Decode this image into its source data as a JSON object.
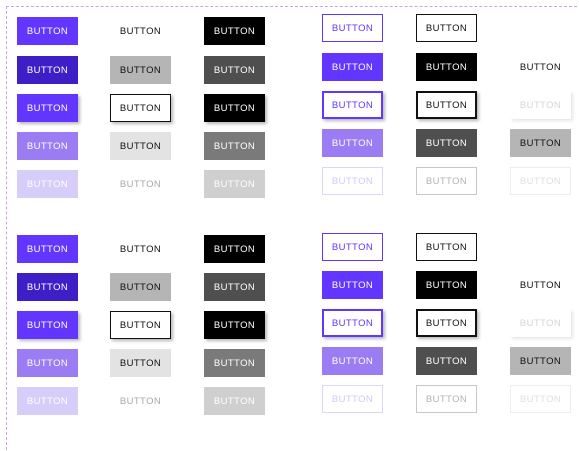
{
  "label": "BUTTON",
  "colors": {
    "purple": "#6236ff",
    "purple_dark": "#3e1ec7",
    "purple_mid": "#9b7cf2",
    "purple_light": "#d7cdf9",
    "gray_dark": "#4f4f4f",
    "gray_mid": "#7a7a7a",
    "gray_light": "#b5b5b5",
    "gray_faint": "#cfcfcf",
    "frame": "#c9a2ef"
  },
  "groups": [
    {
      "id": "top",
      "buttons": [
        {
          "name": "btn-g1-c1-r1",
          "variant": "filled-purple"
        },
        {
          "name": "btn-g1-c1-r2",
          "variant": "filled-purple-dark"
        },
        {
          "name": "btn-g1-c1-r3",
          "variant": "filled-purple-elevated"
        },
        {
          "name": "btn-g1-c1-r4",
          "variant": "filled-purple-hover"
        },
        {
          "name": "btn-g1-c1-r5",
          "variant": "filled-purple-disabled"
        },
        {
          "name": "btn-g1-c2-r1",
          "variant": "text"
        },
        {
          "name": "btn-g1-c2-r2",
          "variant": "text-gray-bg"
        },
        {
          "name": "btn-g1-c2-r3",
          "variant": "text-outlined-elevated"
        },
        {
          "name": "btn-g1-c2-r4",
          "variant": "text-light-bg"
        },
        {
          "name": "btn-g1-c2-r5",
          "variant": "text-disabled"
        },
        {
          "name": "btn-g1-c3-r1",
          "variant": "filled-black"
        },
        {
          "name": "btn-g1-c3-r2",
          "variant": "filled-gray-dark"
        },
        {
          "name": "btn-g1-c3-r3",
          "variant": "filled-black-elevated"
        },
        {
          "name": "btn-g1-c3-r4",
          "variant": "filled-gray-mid"
        },
        {
          "name": "btn-g1-c3-r5",
          "variant": "filled-gray-disabled"
        },
        {
          "name": "btn-g1-c4-r1",
          "variant": "outline-purple"
        },
        {
          "name": "btn-g1-c4-r2",
          "variant": "filled-purple"
        },
        {
          "name": "btn-g1-c4-r3",
          "variant": "outline-purple-elevated"
        },
        {
          "name": "btn-g1-c4-r4",
          "variant": "filled-purple-hover"
        },
        {
          "name": "btn-g1-c4-r5",
          "variant": "outline-purple-disabled"
        },
        {
          "name": "btn-g1-c5-r1",
          "variant": "outline-black"
        },
        {
          "name": "btn-g1-c5-r2",
          "variant": "filled-black"
        },
        {
          "name": "btn-g1-c5-r3",
          "variant": "outline-black-elevated"
        },
        {
          "name": "btn-g1-c5-r4",
          "variant": "filled-gray-dark"
        },
        {
          "name": "btn-g1-c5-r5",
          "variant": "outline-gray-disabled"
        },
        {
          "name": "btn-g1-c6-r2",
          "variant": "text"
        },
        {
          "name": "btn-g1-c6-r3",
          "variant": "text-disabled-elevated"
        },
        {
          "name": "btn-g1-c6-r4",
          "variant": "text-gray-bg"
        },
        {
          "name": "btn-g1-c6-r5",
          "variant": "outline-faint-disabled"
        }
      ]
    },
    {
      "id": "bottom",
      "buttons": [
        {
          "name": "btn-g2-c1-r1",
          "variant": "filled-purple"
        },
        {
          "name": "btn-g2-c1-r2",
          "variant": "filled-purple-dark"
        },
        {
          "name": "btn-g2-c1-r3",
          "variant": "filled-purple-elevated"
        },
        {
          "name": "btn-g2-c1-r4",
          "variant": "filled-purple-hover"
        },
        {
          "name": "btn-g2-c1-r5",
          "variant": "filled-purple-disabled"
        },
        {
          "name": "btn-g2-c2-r1",
          "variant": "text"
        },
        {
          "name": "btn-g2-c2-r2",
          "variant": "text-gray-bg"
        },
        {
          "name": "btn-g2-c2-r3",
          "variant": "text-outlined-elevated"
        },
        {
          "name": "btn-g2-c2-r4",
          "variant": "text-light-bg"
        },
        {
          "name": "btn-g2-c2-r5",
          "variant": "text-disabled"
        },
        {
          "name": "btn-g2-c3-r1",
          "variant": "filled-black"
        },
        {
          "name": "btn-g2-c3-r2",
          "variant": "filled-gray-dark"
        },
        {
          "name": "btn-g2-c3-r3",
          "variant": "filled-black-elevated"
        },
        {
          "name": "btn-g2-c3-r4",
          "variant": "filled-gray-mid"
        },
        {
          "name": "btn-g2-c3-r5",
          "variant": "filled-gray-disabled"
        },
        {
          "name": "btn-g2-c4-r1",
          "variant": "outline-purple"
        },
        {
          "name": "btn-g2-c4-r2",
          "variant": "filled-purple"
        },
        {
          "name": "btn-g2-c4-r3",
          "variant": "outline-purple-elevated"
        },
        {
          "name": "btn-g2-c4-r4",
          "variant": "filled-purple-hover"
        },
        {
          "name": "btn-g2-c4-r5",
          "variant": "outline-purple-disabled"
        },
        {
          "name": "btn-g2-c5-r1",
          "variant": "outline-black"
        },
        {
          "name": "btn-g2-c5-r2",
          "variant": "filled-black"
        },
        {
          "name": "btn-g2-c5-r3",
          "variant": "outline-black-elevated"
        },
        {
          "name": "btn-g2-c5-r4",
          "variant": "filled-gray-dark"
        },
        {
          "name": "btn-g2-c5-r5",
          "variant": "outline-gray-disabled"
        },
        {
          "name": "btn-g2-c6-r2",
          "variant": "text"
        },
        {
          "name": "btn-g2-c6-r3",
          "variant": "text-disabled-elevated"
        },
        {
          "name": "btn-g2-c6-r4",
          "variant": "text-gray-bg"
        },
        {
          "name": "btn-g2-c6-r5",
          "variant": "outline-faint-disabled"
        }
      ]
    }
  ]
}
